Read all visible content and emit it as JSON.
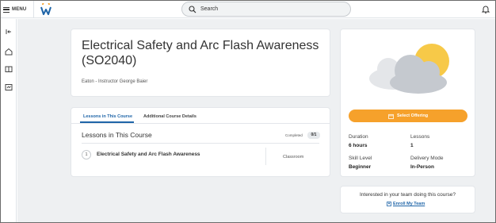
{
  "topbar": {
    "menu_label": "MENU",
    "search_placeholder": "Search",
    "icons": [
      "hamburger-icon",
      "workday-logo",
      "search-icon",
      "bell-icon"
    ]
  },
  "rail": {
    "icons": [
      "collapse-icon",
      "home-icon",
      "book-icon",
      "learning-icon"
    ]
  },
  "course": {
    "title": "Electrical Safety and Arc Flash Awareness (SO2040)",
    "instructor": "Eaton - Instructor George Baier"
  },
  "tabs": [
    {
      "label": "Lessons in This Course",
      "active": true
    },
    {
      "label": "Additional Course Details",
      "active": false
    }
  ],
  "lessons": {
    "heading": "Lessons in This Course",
    "completed_label": "Completed",
    "completed_count": "0/1",
    "items": [
      {
        "number": "1",
        "name": "Electrical Safety and Arc Flash Awareness",
        "type": "Classroom"
      }
    ]
  },
  "offering": {
    "button_label": "Select Offering",
    "duration_label": "Duration",
    "duration_value": "6 hours",
    "lessons_label": "Lessons",
    "lessons_value": "1",
    "skill_label": "Skill Level",
    "skill_value": "Beginner",
    "delivery_label": "Delivery Mode",
    "delivery_value": "In-Person"
  },
  "team": {
    "question": "Interested in your team doing this course?",
    "enroll_label": "Enroll My Team"
  },
  "colors": {
    "accent_blue": "#1f65a8",
    "button_orange": "#f6a12b",
    "sun_yellow": "#f7c948",
    "cloud_gray": "#c5c9cf"
  }
}
